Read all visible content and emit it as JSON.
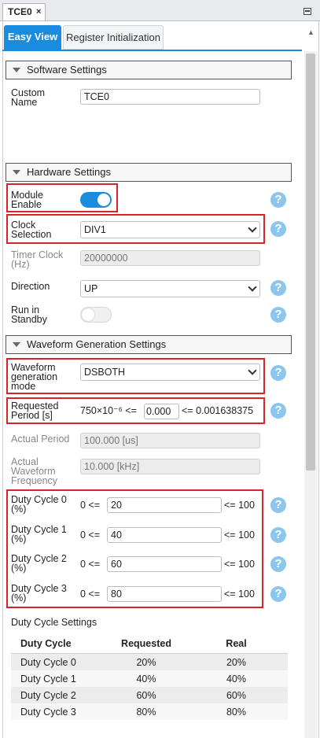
{
  "document_tab": {
    "title": "TCE0",
    "close_glyph": "×"
  },
  "view_tabs": {
    "easy_view": "Easy View",
    "register_init": "Register Initialization"
  },
  "software": {
    "header": "Software Settings",
    "custom_name_label": "Custom Name",
    "custom_name_value": "TCE0"
  },
  "hardware": {
    "header": "Hardware Settings",
    "module_enable_label": "Module Enable",
    "module_enable_on": true,
    "clock_label": "Clock Selection",
    "clock_value": "DIV1",
    "timer_clock_label": "Timer Clock (Hz)",
    "timer_clock_value": "20000000",
    "direction_label": "Direction",
    "direction_value": "UP",
    "run_standby_label": "Run in Standby",
    "run_standby_on": false
  },
  "waveform": {
    "header": "Waveform Generation Settings",
    "mode_label": "Waveform generation mode",
    "mode_value": "DSBOTH",
    "period_label": "Requested Period [s]",
    "period_min": "750×10⁻⁶ <=",
    "period_value": "0.000",
    "period_max": "<= 0.001638375",
    "actual_period_label": "Actual Period",
    "actual_period_value": "100.000 [us]",
    "actual_freq_label": "Actual Waveform Frequency",
    "actual_freq_value": "10.000 [kHz]"
  },
  "duty_inputs": [
    {
      "label": "Duty Cycle 0 (%)",
      "min": "0 <=",
      "value": "20",
      "max": "<= 100"
    },
    {
      "label": "Duty Cycle 1 (%)",
      "min": "0 <=",
      "value": "40",
      "max": "<= 100"
    },
    {
      "label": "Duty Cycle 2 (%)",
      "min": "0 <=",
      "value": "60",
      "max": "<= 100"
    },
    {
      "label": "Duty Cycle 3 (%)",
      "min": "0 <=",
      "value": "80",
      "max": "<= 100"
    }
  ],
  "duty_table": {
    "title": "Duty Cycle Settings",
    "headers": [
      "Duty Cycle",
      "Requested",
      "Real"
    ],
    "rows": [
      [
        "Duty Cycle 0",
        "20%",
        "20%"
      ],
      [
        "Duty Cycle 1",
        "40%",
        "40%"
      ],
      [
        "Duty Cycle 2",
        "60%",
        "60%"
      ],
      [
        "Duty Cycle 3",
        "80%",
        "80%"
      ]
    ]
  },
  "help_glyph": "?",
  "colors": {
    "accent": "#1a8ce0",
    "highlight_border": "#d9222a",
    "help_icon": "#8cc6ee"
  }
}
